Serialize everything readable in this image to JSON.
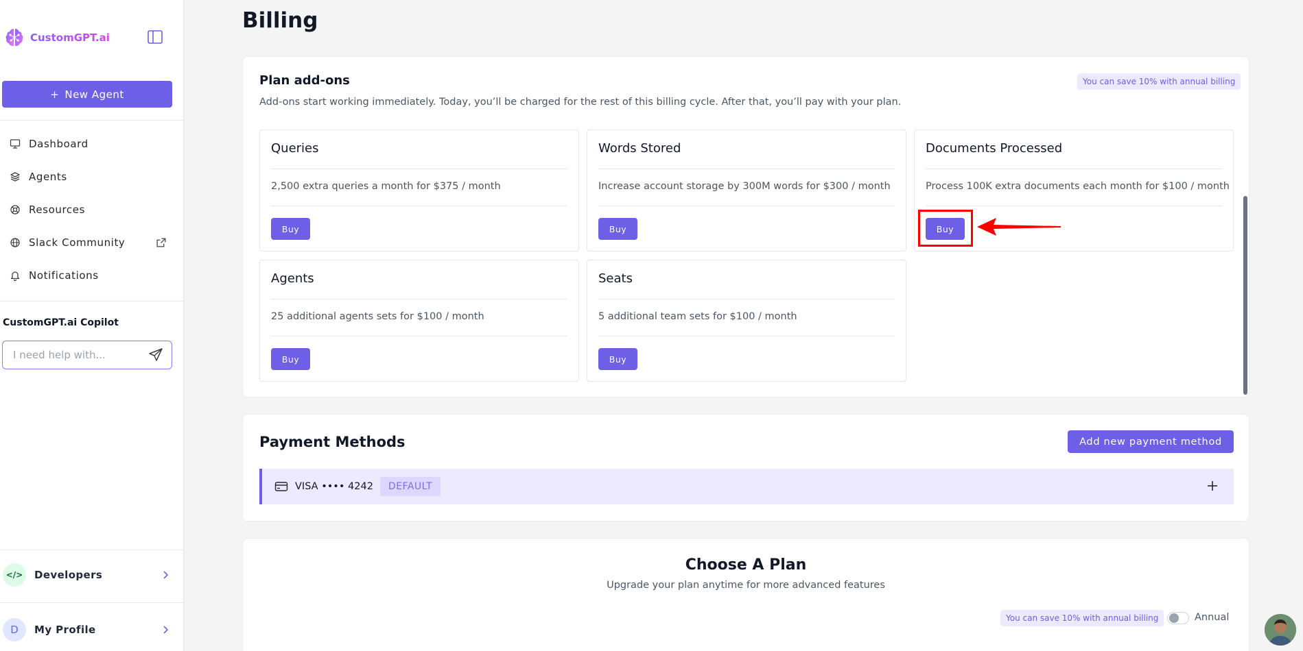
{
  "sidebar": {
    "brand": "CustomGPT.ai",
    "new_agent_label": "New Agent",
    "nav": [
      {
        "label": "Dashboard",
        "icon": "dashboard-icon"
      },
      {
        "label": "Agents",
        "icon": "layers-icon"
      },
      {
        "label": "Resources",
        "icon": "lifebuoy-icon"
      },
      {
        "label": "Slack Community",
        "icon": "globe-icon",
        "external": true
      },
      {
        "label": "Notifications",
        "icon": "bell-icon"
      }
    ],
    "copilot": {
      "title": "CustomGPT.ai Copilot",
      "placeholder": "I need help with..."
    },
    "developers": {
      "label": "Developers",
      "badge": "</>"
    },
    "profile": {
      "label": "My Profile",
      "initial": "D"
    }
  },
  "page": {
    "title": "Billing"
  },
  "addons": {
    "heading": "Plan add-ons",
    "description": "Add-ons start working immediately. Today, you’ll be charged for the rest of this billing cycle. After that, you’ll pay with your plan.",
    "save_badge": "You can save 10% with annual billing",
    "items": [
      {
        "title": "Queries",
        "description": "2,500 extra queries a month for $375 / month",
        "button": "Buy"
      },
      {
        "title": "Words Stored",
        "description": "Increase account storage by 300M words for $300 / month",
        "button": "Buy"
      },
      {
        "title": "Documents Processed",
        "description": "Process 100K extra documents each month for $100 / month",
        "button": "Buy"
      },
      {
        "title": "Agents",
        "description": "25 additional agents sets for $100 / month",
        "button": "Buy"
      },
      {
        "title": "Seats",
        "description": "5 additional team sets for $100 / month",
        "button": "Buy"
      }
    ]
  },
  "payment": {
    "heading": "Payment Methods",
    "add_button": "Add new payment method",
    "methods": [
      {
        "label": "VISA •••• 4242",
        "badge": "DEFAULT"
      }
    ]
  },
  "plan": {
    "title": "Choose A Plan",
    "subtitle": "Upgrade your plan anytime for more advanced features",
    "save_badge": "You can save 10% with annual billing",
    "toggle_label": "Annual"
  },
  "colors": {
    "accent": "#6d5fe6",
    "accent_light": "#ede9fe",
    "annotation": "#ff0000"
  }
}
